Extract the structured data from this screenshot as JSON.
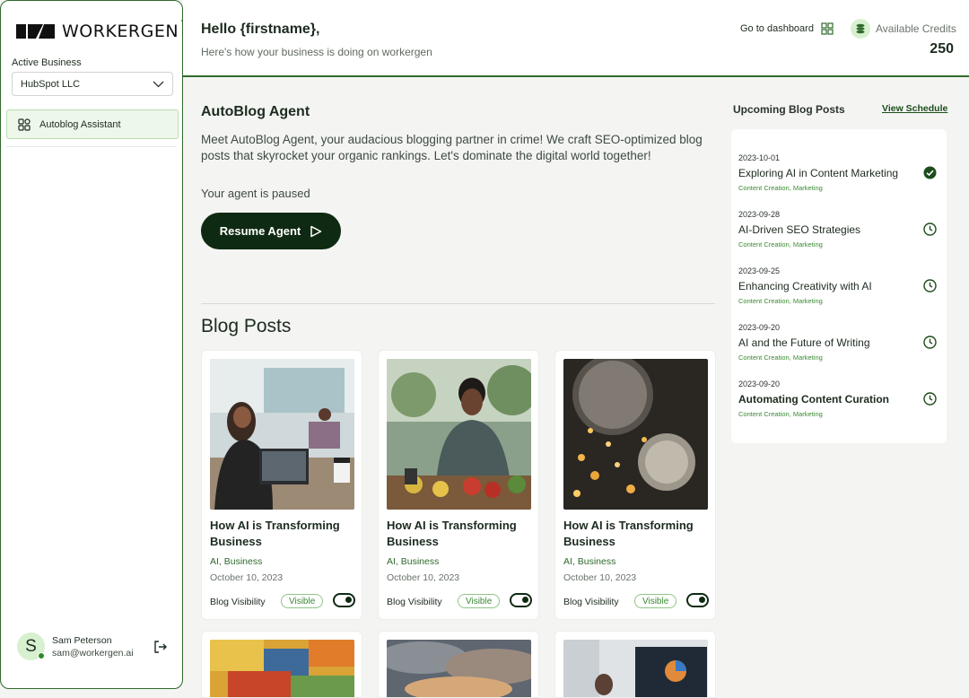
{
  "brand": {
    "name": "WORKERGEN",
    "tm": "™"
  },
  "sidebar": {
    "active_business_label": "Active Business",
    "business_value": "HubSpot LLC",
    "nav_items": [
      {
        "label": "Autoblog Assistant",
        "icon": "grid-icon"
      }
    ]
  },
  "user": {
    "initial": "S",
    "name": "Sam Peterson",
    "email": "sam@workergen.ai"
  },
  "header": {
    "greeting": "Hello {firstname},",
    "subtitle": "Here's how your business is doing on workergen",
    "dashboard_link": "Go to dashboard",
    "credits_label": "Available Credits",
    "credits_value": "250"
  },
  "agent": {
    "title": "AutoBlog Agent",
    "description": "Meet AutoBlog Agent, your audacious blogging partner in crime! We craft SEO-optimized blog posts that skyrocket your organic rankings. Let's dominate the digital world together!",
    "status": "Your agent is paused",
    "resume_label": "Resume Agent"
  },
  "blog": {
    "title": "Blog Posts",
    "posts": [
      {
        "title": "How AI is Transforming Business",
        "tags": "AI, Business",
        "date": "October 10, 2023",
        "visibility_label": "Blog Visibility",
        "badge": "Visible",
        "image": "office-meeting-photo"
      },
      {
        "title": "How AI is Transforming Business",
        "tags": "AI, Business",
        "date": "October 10, 2023",
        "visibility_label": "Blog Visibility",
        "badge": "Visible",
        "image": "market-vendor-photo"
      },
      {
        "title": "How AI is Transforming Business",
        "tags": "AI, Business",
        "date": "October 10, 2023",
        "visibility_label": "Blog Visibility",
        "badge": "Visible",
        "image": "lightbulb-bokeh-photo"
      }
    ]
  },
  "upcoming": {
    "title": "Upcoming Blog Posts",
    "view_schedule": "View Schedule",
    "items": [
      {
        "date": "2023-10-01",
        "title": "Exploring AI in Content Marketing",
        "tags": "Content Creation, Marketing",
        "status": "check-icon"
      },
      {
        "date": "2023-09-28",
        "title": "AI-Driven SEO Strategies",
        "tags": "Content Creation, Marketing",
        "status": "clock-icon"
      },
      {
        "date": "2023-09-25",
        "title": "Enhancing Creativity with AI",
        "tags": "Content Creation, Marketing",
        "status": "clock-icon"
      },
      {
        "date": "2023-09-20",
        "title": "AI and the Future of Writing",
        "tags": "Content Creation, Marketing",
        "status": "clock-icon"
      },
      {
        "date": "2023-09-20",
        "title": "Automating Content Curation",
        "tags": "Content Creation, Marketing",
        "status": "clock-icon"
      }
    ]
  },
  "colors": {
    "brand_dark": "#0f2a12",
    "accent": "#2f6a2c",
    "accent_light": "#d7f0cf"
  }
}
